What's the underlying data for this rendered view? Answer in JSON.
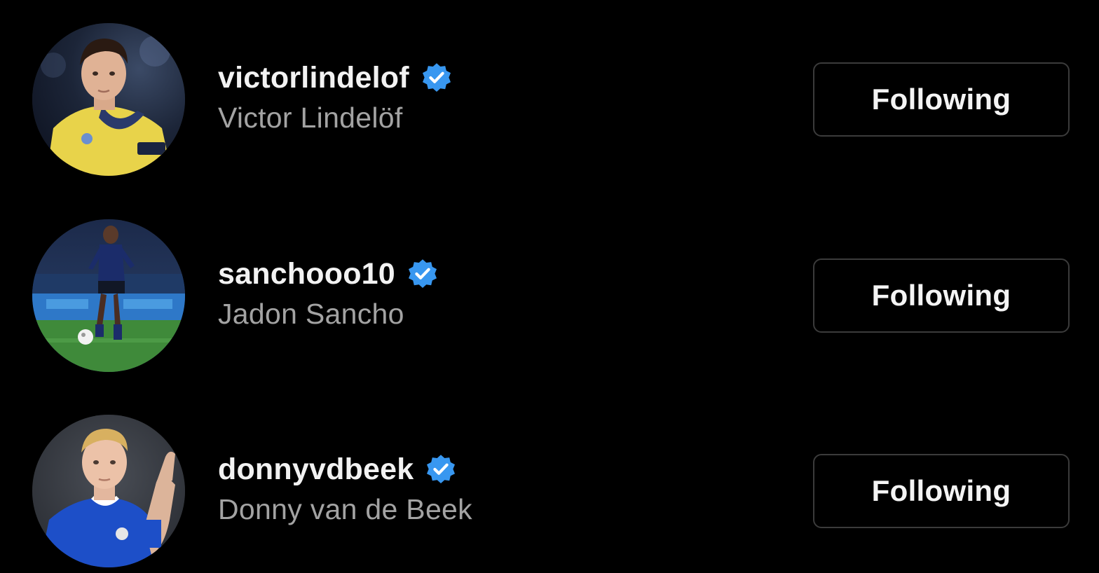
{
  "accent_color": "#3897f0",
  "verified_icon": "verified-badge-icon",
  "users": [
    {
      "username": "victorlindelof",
      "full_name": "Victor Lindelöf",
      "verified": true,
      "avatar": "profile-photo-player-yellow-kit",
      "follow_button_label": "Following"
    },
    {
      "username": "sanchooo10",
      "full_name": "Jadon Sancho",
      "verified": true,
      "avatar": "profile-photo-player-on-pitch",
      "follow_button_label": "Following"
    },
    {
      "username": "donnyvdbeek",
      "full_name": "Donny van de Beek",
      "verified": true,
      "avatar": "profile-photo-player-blue-kit",
      "follow_button_label": "Following"
    }
  ]
}
